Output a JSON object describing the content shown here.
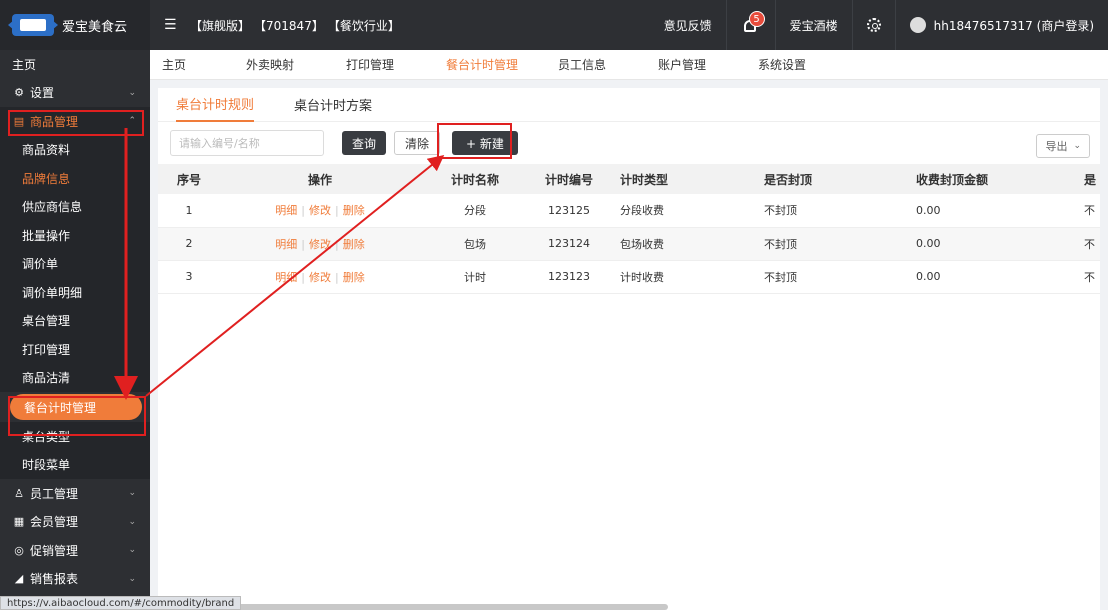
{
  "topbar": {
    "brand": "爱宝美食云",
    "tag_edition": "【旗舰版】",
    "tag_id": "【701847】",
    "tag_industry": "【餐饮行业】",
    "feedback": "意见反馈",
    "notification_count": "5",
    "store_name": "爱宝酒楼",
    "user": "hh18476517317 (商户登录)"
  },
  "sidebar": {
    "home": "主页",
    "settings": "设置",
    "goods": "商品管理",
    "sub": [
      "商品资料",
      "品牌信息",
      "供应商信息",
      "批量操作",
      "调价单",
      "调价单明细",
      "桌台管理",
      "打印管理",
      "商品沽清",
      "餐台计时管理",
      "桌台类型",
      "时段菜单"
    ],
    "staff": "员工管理",
    "member": "会员管理",
    "promo": "促销管理",
    "sales": "销售报表"
  },
  "navbar": [
    "主页",
    "外卖映射",
    "打印管理",
    "餐台计时管理",
    "员工信息",
    "账户管理",
    "系统设置"
  ],
  "subtabs": [
    "桌台计时规则",
    "桌台计时方案"
  ],
  "toolbar": {
    "search_placeholder": "请输入编号/名称",
    "query": "查询",
    "clear": "清除",
    "new": "+ 新建",
    "export": "导出"
  },
  "table": {
    "headers": [
      "序号",
      "操作",
      "计时名称",
      "计时编号",
      "计时类型",
      "是否封顶",
      "收费封顶金额",
      "是"
    ],
    "ops": [
      "明细",
      "修改",
      "删除"
    ],
    "rows": [
      [
        "1",
        "分段",
        "123125",
        "分段收费",
        "不封顶",
        "0.00",
        "不"
      ],
      [
        "2",
        "包场",
        "123124",
        "包场收费",
        "不封顶",
        "0.00",
        "不"
      ],
      [
        "3",
        "计时",
        "123123",
        "计时收费",
        "不封顶",
        "0.00",
        "不"
      ]
    ]
  },
  "status_url": "https://v.aibaocloud.com/#/commodity/brand",
  "colors": {
    "accent": "#f07c3a",
    "annotation": "#e02020"
  }
}
